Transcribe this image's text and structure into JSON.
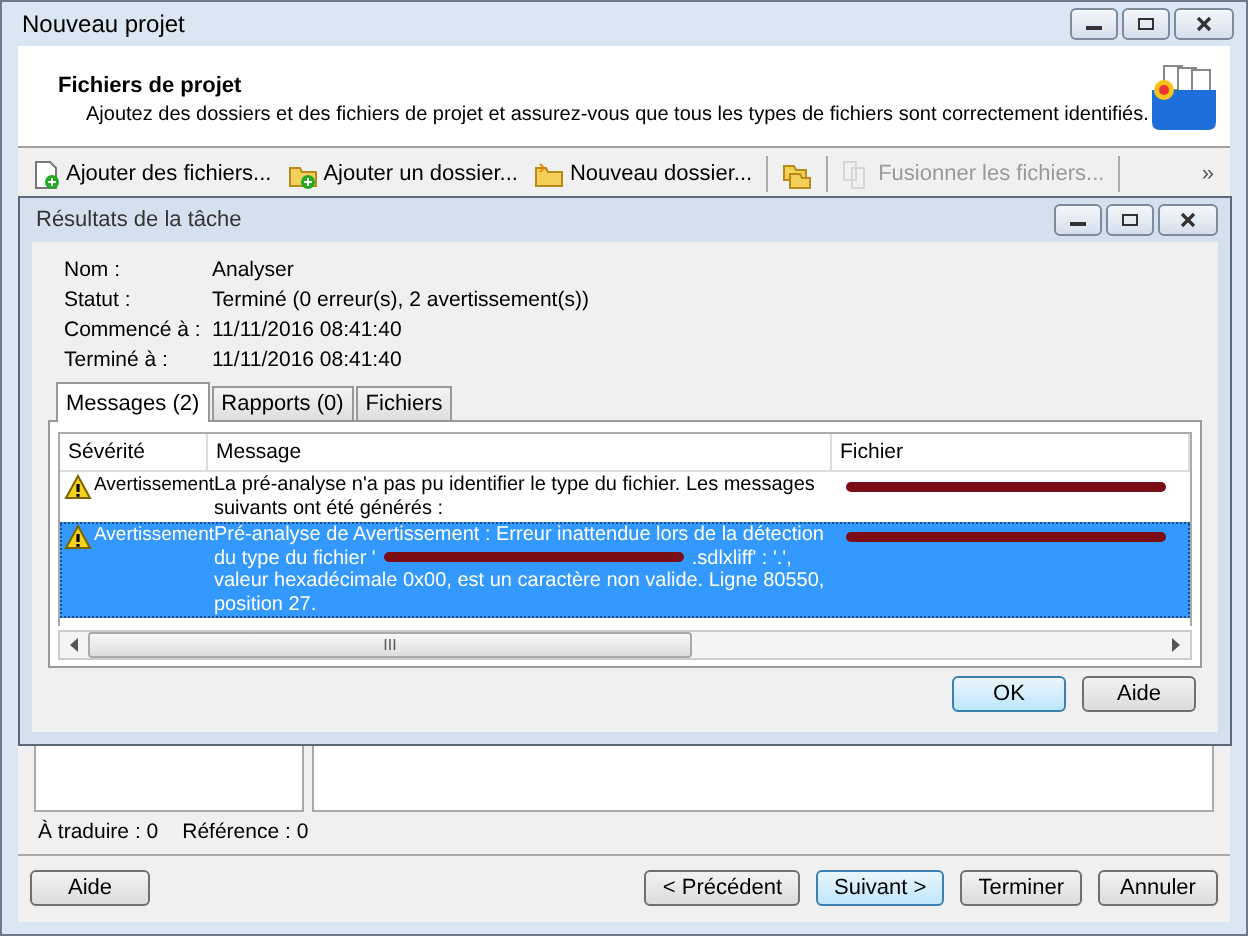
{
  "window": {
    "title": "Nouveau projet"
  },
  "header": {
    "title": "Fichiers de projet",
    "description": "Ajoutez des dossiers et des fichiers de projet et assurez-vous que tous les types de fichiers sont correctement identifiés."
  },
  "toolbar": {
    "items": [
      {
        "kind": "file-add",
        "label": "Ajouter des fichiers...",
        "disabled": false
      },
      {
        "kind": "folder-add",
        "label": "Ajouter un dossier...",
        "disabled": false
      },
      {
        "kind": "folder-new",
        "label": "Nouveau dossier...",
        "disabled": false
      },
      {
        "kind": "folders",
        "disabled": false
      },
      {
        "kind": "merge",
        "label": "Fusionner les fichiers...",
        "disabled": true
      }
    ],
    "overflow": "»"
  },
  "dialog": {
    "title": "Résultats de la tâche",
    "info": [
      {
        "label": "Nom :",
        "value": "Analyser"
      },
      {
        "label": "Statut :",
        "value": "Terminé (0 erreur(s), 2 avertissement(s))"
      },
      {
        "label": "Commencé à :",
        "value": "11/11/2016 08:41:40"
      },
      {
        "label": "Terminé à :",
        "value": "11/11/2016 08:41:40"
      }
    ],
    "tabs": [
      {
        "label": "Messages (2)",
        "selected": true
      },
      {
        "label": "Rapports (0)",
        "selected": false
      },
      {
        "label": "Fichiers",
        "selected": false
      }
    ],
    "columns": [
      "Sévérité",
      "Message",
      "Fichier"
    ],
    "rows": [
      {
        "severity": "Avertissement",
        "message": "La pré-analyse n'a pas pu identifier le type du fichier. Les messages suivants ont été générés :",
        "message_tail": "",
        "selected": false
      },
      {
        "severity": "Avertissement",
        "message": "Pré-analyse de Avertissement : Erreur inattendue lors de la détection du type du fichier '",
        "message_tail": ".sdlxliff' : '.', valeur hexadécimale 0x00, est un caractère non valide. Ligne 80550, position 27.",
        "selected": true
      }
    ],
    "scroll_grip": "III",
    "buttons": [
      {
        "label": "OK",
        "default": true
      },
      {
        "label": "Aide",
        "default": false
      }
    ]
  },
  "status": [
    "À traduire : 0",
    "Référence : 0"
  ],
  "buttons": {
    "left": [
      {
        "label": "Aide",
        "default": false
      }
    ],
    "right": [
      {
        "label": "< Précédent",
        "default": false
      },
      {
        "label": "Suivant >",
        "default": true
      },
      {
        "label": "Terminer",
        "default": false
      },
      {
        "label": "Annuler",
        "default": false
      }
    ]
  }
}
